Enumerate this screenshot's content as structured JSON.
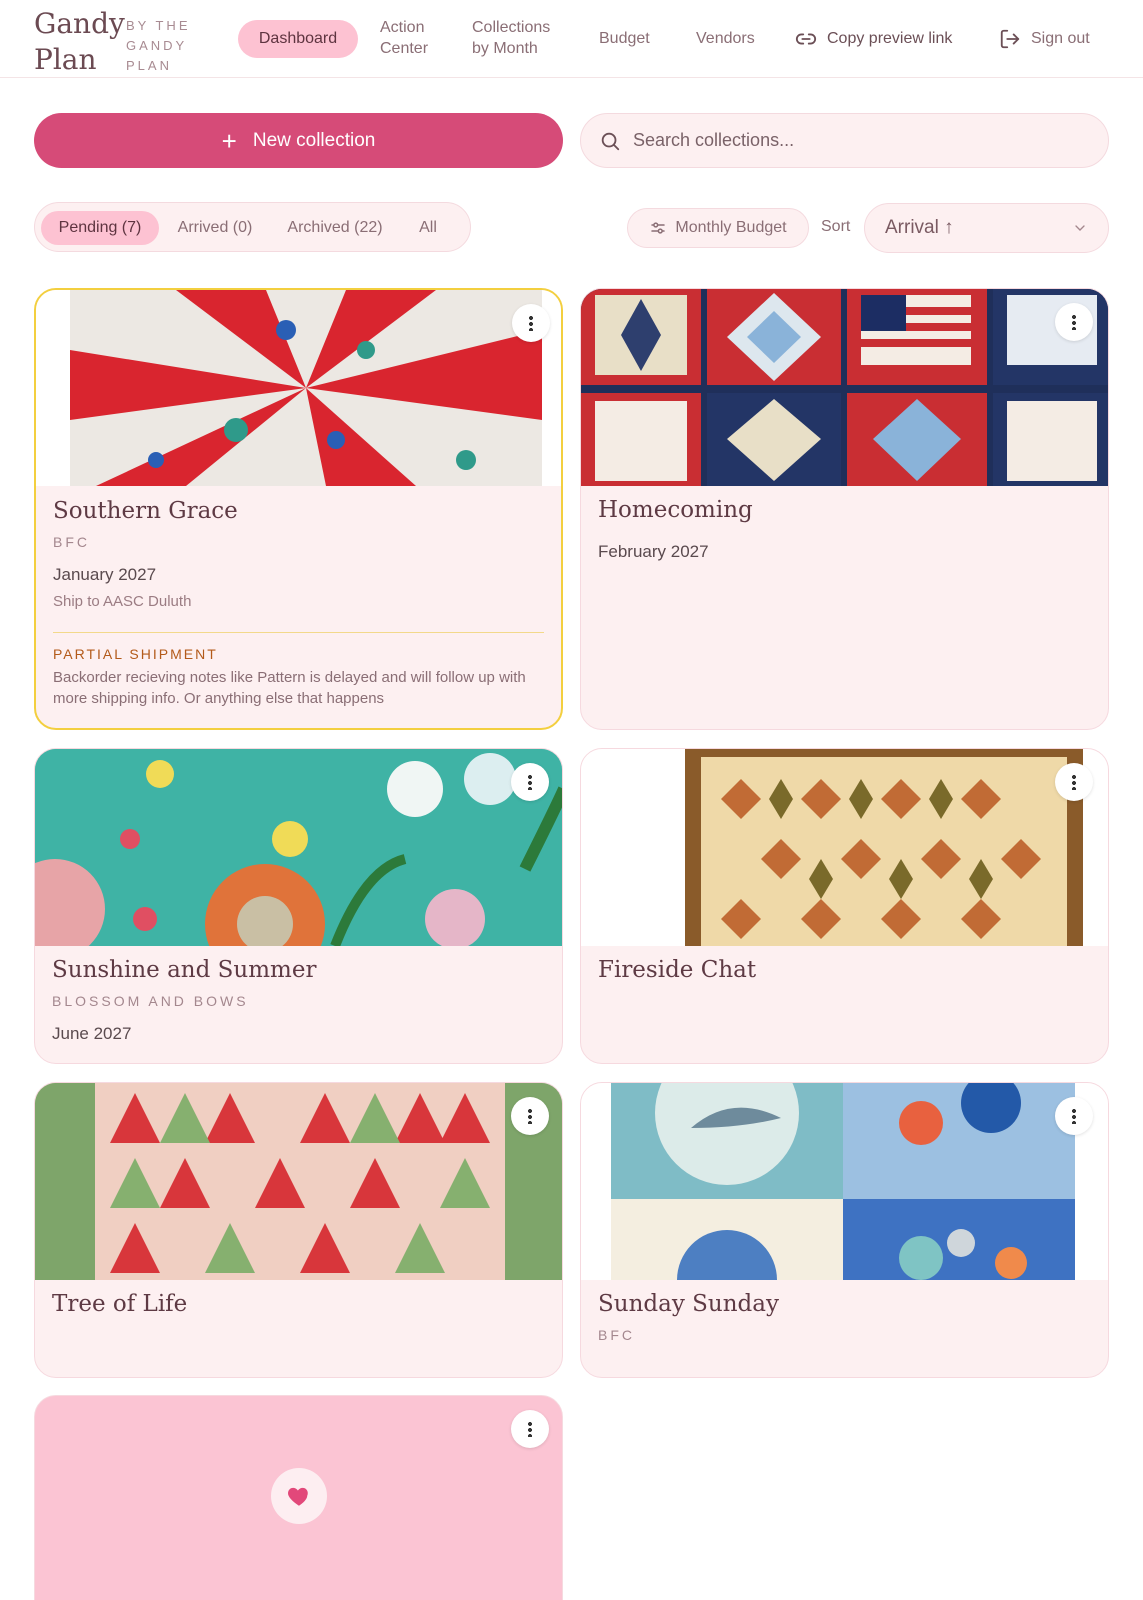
{
  "brand": {
    "name_line1": "Gandy",
    "name_line2": "Plan",
    "tagline": "BY THE GANDY PLAN"
  },
  "nav": {
    "dashboard": "Dashboard",
    "action_center_1": "Action",
    "action_center_2": "Center",
    "collections_1": "Collections",
    "collections_2": "by Month",
    "budget": "Budget",
    "vendors": "Vendors",
    "copy_link": "Copy preview link",
    "sign_out": "Sign out"
  },
  "actions": {
    "new_collection": "New collection",
    "search_placeholder": "Search collections..."
  },
  "filters": {
    "tabs": [
      {
        "label": "Pending (7)",
        "active": true
      },
      {
        "label": "Arrived (0)",
        "active": false
      },
      {
        "label": "Archived (22)",
        "active": false
      },
      {
        "label": "All",
        "active": false
      }
    ],
    "monthly_budget": "Monthly Budget",
    "sort_label": "Sort",
    "sort_value": "Arrival ↑"
  },
  "cards": [
    {
      "title": "Southern Grace",
      "subtitle": "BFC",
      "date": "January 2027",
      "ship_to": "Ship to AASC Duluth",
      "warning_title": "PARTIAL SHIPMENT",
      "warning_note": "Backorder recieving notes like Pattern is delayed and will follow up with more shipping info. Or anything else that happens"
    },
    {
      "title": "Homecoming",
      "date": "February 2027"
    },
    {
      "title": "Sunshine and Summer",
      "subtitle": "BLOSSOM AND BOWS",
      "date": "June 2027"
    },
    {
      "title": "Fireside Chat"
    },
    {
      "title": "Tree of Life"
    },
    {
      "title": "Sunday Sunday",
      "subtitle": "BFC"
    },
    {
      "title": ""
    }
  ],
  "colors": {
    "accent": "#d64b78",
    "pill": "#fdc2d2",
    "card_bg": "#fdf0f1",
    "highlight_border": "#f3cf3f"
  }
}
